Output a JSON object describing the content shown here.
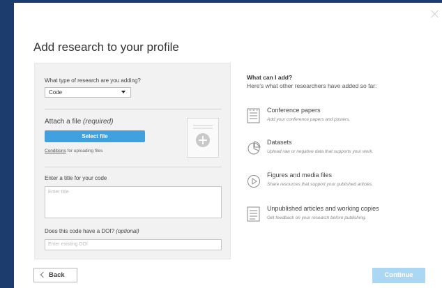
{
  "dialog": {
    "title": "Add research to your profile"
  },
  "form": {
    "type_question": "What type of research are you adding?",
    "type_selected": "Code",
    "attach_label": "Attach a file",
    "attach_required": "(required)",
    "select_file_button": "Select file",
    "conditions_link": "Conditions",
    "conditions_suffix": " for uploading files",
    "title_label": "Enter a title for your code",
    "title_placeholder": "Enter title",
    "doi_label": "Does this code have a DOI?",
    "doi_optional": "(optional)",
    "doi_placeholder": "Enter existing DOI"
  },
  "info": {
    "heading": "What can I add?",
    "subheading": "Here's what other researchers have added so far:",
    "items": [
      {
        "icon": "document-icon",
        "title": "Conference papers",
        "desc": "Add your conference papers and posters."
      },
      {
        "icon": "pie-chart-icon",
        "title": "Datasets",
        "desc": "Upload raw or negative data that supports your work."
      },
      {
        "icon": "play-icon",
        "title": "Figures and media files",
        "desc": "Share resources that support your published articles."
      },
      {
        "icon": "article-icon",
        "title": "Unpublished articles and working copies",
        "desc": "Get feedback on your research before publishing."
      }
    ]
  },
  "footer": {
    "back_label": "Back",
    "continue_label": "Continue"
  },
  "colors": {
    "backdrop": "#1d3c6e",
    "primary_button": "#3fa1e0",
    "disabled_button": "#a9d7f4"
  }
}
